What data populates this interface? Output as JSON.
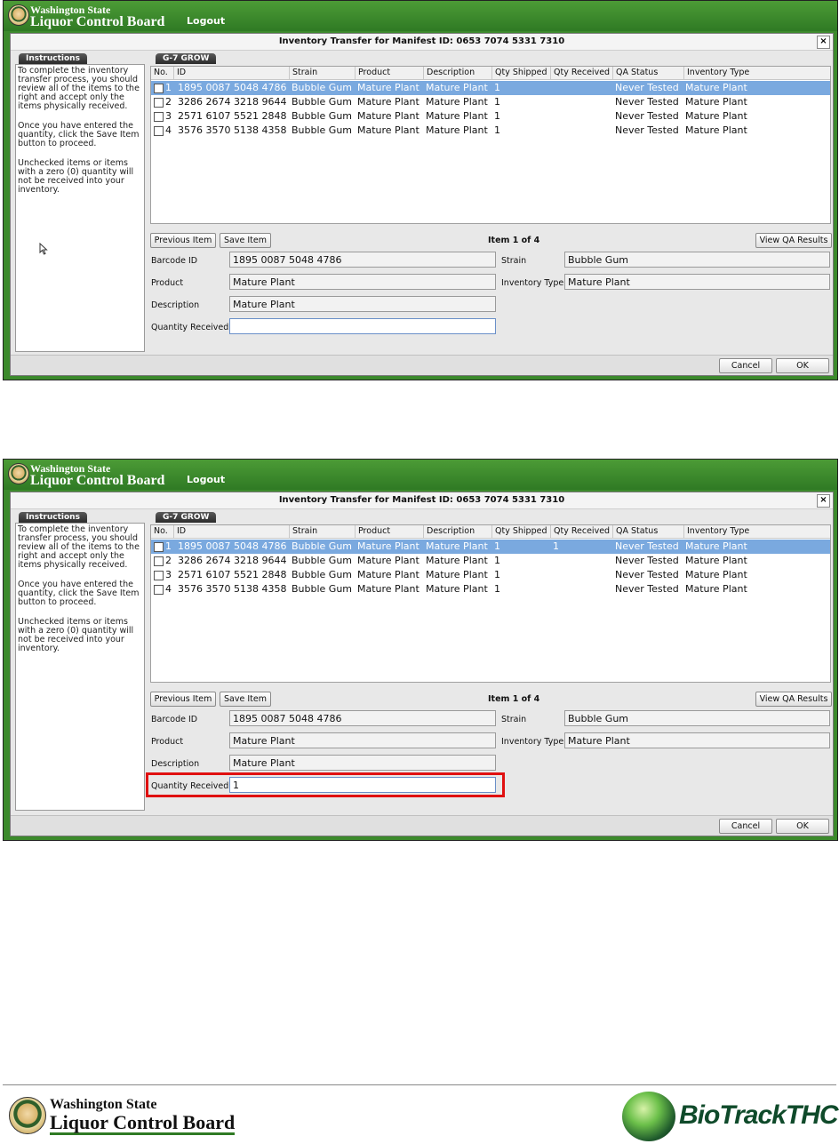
{
  "header": {
    "brand_line1": "Washington State",
    "brand_line2": "Liquor Control Board",
    "logout": "Logout"
  },
  "dialog": {
    "title": "Inventory Transfer for Manifest ID: 0653 7074 5331 7310",
    "close": "×"
  },
  "instructions": {
    "tab": "Instructions",
    "paragraphs": [
      "To complete the inventory transfer process, you should review all of the items to the right and accept only the items physically received.",
      "Once you have entered the quantity, click the Save Item button to proceed.",
      "Unchecked items or items with a zero (0) quantity will not be received into your inventory."
    ]
  },
  "grid": {
    "tab": "G-7 GROW",
    "columns": [
      "No.",
      "ID",
      "Strain",
      "Product",
      "Description",
      "Qty Shipped",
      "Qty Received",
      "QA Status",
      "Inventory Type"
    ],
    "rows_first": [
      {
        "no": "1",
        "id": "1895 0087 5048 4786",
        "strain": "Bubble Gum",
        "product": "Mature Plant",
        "description": "Mature Plant",
        "qty_shipped": "1",
        "qty_received": "",
        "qa_status": "Never Tested",
        "inventory_type": "Mature Plant"
      },
      {
        "no": "2",
        "id": "3286 2674 3218 9644",
        "strain": "Bubble Gum",
        "product": "Mature Plant",
        "description": "Mature Plant",
        "qty_shipped": "1",
        "qty_received": "",
        "qa_status": "Never Tested",
        "inventory_type": "Mature Plant"
      },
      {
        "no": "3",
        "id": "2571 6107 5521 2848",
        "strain": "Bubble Gum",
        "product": "Mature Plant",
        "description": "Mature Plant",
        "qty_shipped": "1",
        "qty_received": "",
        "qa_status": "Never Tested",
        "inventory_type": "Mature Plant"
      },
      {
        "no": "4",
        "id": "3576 3570 5138 4358",
        "strain": "Bubble Gum",
        "product": "Mature Plant",
        "description": "Mature Plant",
        "qty_shipped": "1",
        "qty_received": "",
        "qa_status": "Never Tested",
        "inventory_type": "Mature Plant"
      }
    ],
    "rows_second": [
      {
        "no": "1",
        "id": "1895 0087 5048 4786",
        "strain": "Bubble Gum",
        "product": "Mature Plant",
        "description": "Mature Plant",
        "qty_shipped": "1",
        "qty_received": "1",
        "qa_status": "Never Tested",
        "inventory_type": "Mature Plant"
      },
      {
        "no": "2",
        "id": "3286 2674 3218 9644",
        "strain": "Bubble Gum",
        "product": "Mature Plant",
        "description": "Mature Plant",
        "qty_shipped": "1",
        "qty_received": "",
        "qa_status": "Never Tested",
        "inventory_type": "Mature Plant"
      },
      {
        "no": "3",
        "id": "2571 6107 5521 2848",
        "strain": "Bubble Gum",
        "product": "Mature Plant",
        "description": "Mature Plant",
        "qty_shipped": "1",
        "qty_received": "",
        "qa_status": "Never Tested",
        "inventory_type": "Mature Plant"
      },
      {
        "no": "4",
        "id": "3576 3570 5138 4358",
        "strain": "Bubble Gum",
        "product": "Mature Plant",
        "description": "Mature Plant",
        "qty_shipped": "1",
        "qty_received": "",
        "qa_status": "Never Tested",
        "inventory_type": "Mature Plant"
      }
    ]
  },
  "detail": {
    "prev": "Previous Item",
    "save": "Save Item",
    "item_of": "Item 1 of 4",
    "view_qa": "View QA Results",
    "barcode_label": "Barcode ID",
    "barcode_value": "1895 0087 5048 4786",
    "strain_label": "Strain",
    "strain_value": "Bubble Gum",
    "product_label": "Product",
    "product_value": "Mature Plant",
    "invtype_label": "Inventory Type",
    "invtype_value": "Mature Plant",
    "desc_label": "Description",
    "desc_value": "Mature Plant",
    "qty_label": "Quantity Received",
    "qty_value_first": "",
    "qty_value_second": "1"
  },
  "actions": {
    "cancel": "Cancel",
    "ok": "OK"
  },
  "footer": {
    "brand_line1": "Washington State",
    "brand_line2": "Liquor Control Board",
    "biotrack": "BioTrackTHC"
  },
  "colors": {
    "header_green": "#3c8a2c",
    "selection": "#7aa9df",
    "highlight": "#e01010"
  }
}
